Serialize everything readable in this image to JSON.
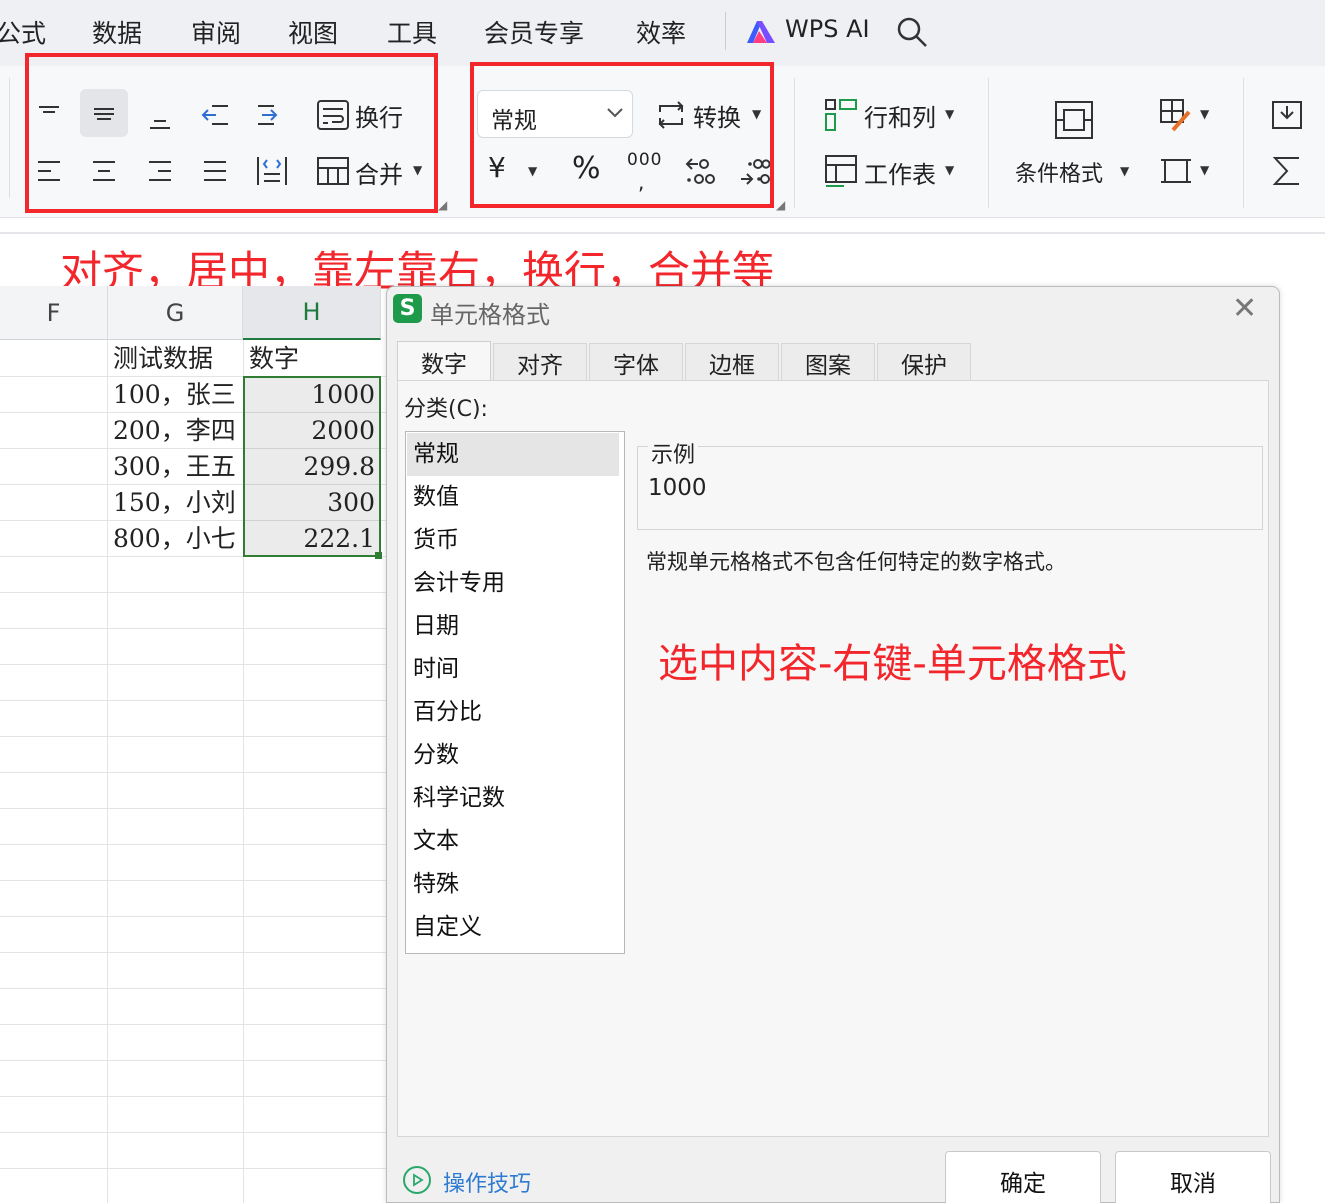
{
  "menu": {
    "items": [
      "公式",
      "数据",
      "审阅",
      "视图",
      "工具",
      "会员专享",
      "效率"
    ],
    "wps_ai": "WPS AI"
  },
  "ribbon": {
    "wrap_label": "换行",
    "merge_label": "合并",
    "number_format": "常规",
    "convert_label": "转换",
    "currency_symbol": "¥",
    "percent_symbol": "%",
    "thousands_symbol": "000",
    "rows_cols_label": "行和列",
    "worksheet_label": "工作表",
    "cond_format_label": "条件格式"
  },
  "annotations": {
    "alignment_note": "对齐，居中，靠左靠右，换行，合并等",
    "format_note": "选中内容-右键-单元格格式"
  },
  "sheet": {
    "columns": [
      "F",
      "G",
      "H"
    ],
    "selected_column": "H",
    "header_row": {
      "g": "测试数据",
      "h": "数字"
    },
    "rows": [
      {
        "g": "100，张三",
        "h": "1000"
      },
      {
        "g": "200，李四",
        "h": "2000"
      },
      {
        "g": "300，王五",
        "h": "299.8"
      },
      {
        "g": "150，小刘",
        "h": "300"
      },
      {
        "g": "800，小七",
        "h": "222.1"
      }
    ]
  },
  "dialog": {
    "title": "单元格格式",
    "tabs": [
      "数字",
      "对齐",
      "字体",
      "边框",
      "图案",
      "保护"
    ],
    "active_tab": "数字",
    "category_label": "分类(C):",
    "categories": [
      "常规",
      "数值",
      "货币",
      "会计专用",
      "日期",
      "时间",
      "百分比",
      "分数",
      "科学记数",
      "文本",
      "特殊",
      "自定义"
    ],
    "selected_category": "常规",
    "sample_label": "示例",
    "sample_value": "1000",
    "description": "常规单元格格式不包含任何特定的数字格式。",
    "tips_label": "操作技巧",
    "ok_label": "确定",
    "cancel_label": "取消"
  },
  "colors": {
    "annotation_red": "#f2262b",
    "selection_green": "#2e7d32",
    "link_blue": "#2e7bd1"
  }
}
